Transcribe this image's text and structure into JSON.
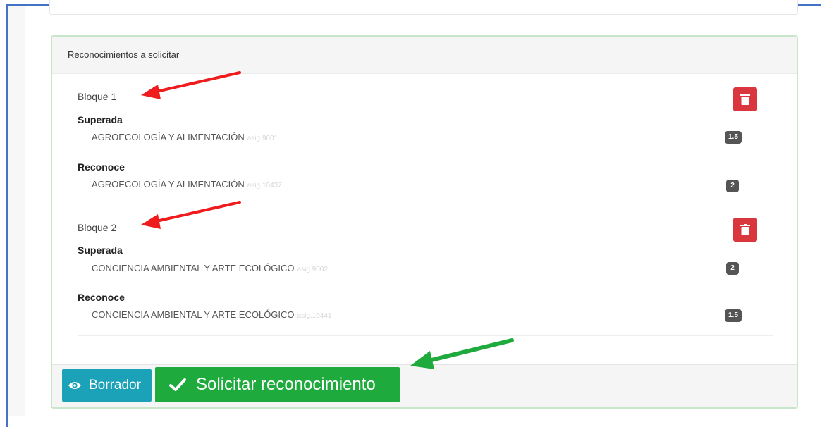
{
  "panel": {
    "heading": "Reconocimientos a solicitar",
    "bloques": [
      {
        "title": "Bloque 1",
        "superada_label": "Superada",
        "superada_course": "AGROECOLOGÍA Y ALIMENTACIÓN",
        "superada_code": "asig.9001",
        "superada_badge": "1.5",
        "reconoce_label": "Reconoce",
        "reconoce_course": "AGROECOLOGÍA Y ALIMENTACIÓN",
        "reconoce_code": "asig.10437",
        "reconoce_badge": "2"
      },
      {
        "title": "Bloque 2",
        "superada_label": "Superada",
        "superada_course": "CONCIENCIA AMBIENTAL Y ARTE ECOLÓGICO",
        "superada_code": "asig.9002",
        "superada_badge": "2",
        "reconoce_label": "Reconoce",
        "reconoce_course": "CONCIENCIA AMBIENTAL Y ARTE ECOLÓGICO",
        "reconoce_code": "asig.10441",
        "reconoce_badge": "1.5"
      }
    ]
  },
  "footer": {
    "borrador_label": "Borrador",
    "solicitar_label": "Solicitar reconocimiento"
  },
  "icons": {
    "delete": "trash-icon",
    "borrador": "eye-icon",
    "solicitar": "check-icon"
  },
  "colors": {
    "delete": "#d9363e",
    "borrador": "#1ba1b8",
    "solicitar": "#1faa3e",
    "annotation_red": "#ee1c1c",
    "annotation_green": "#1faa3e",
    "panel_border": "#c8e6c9"
  }
}
